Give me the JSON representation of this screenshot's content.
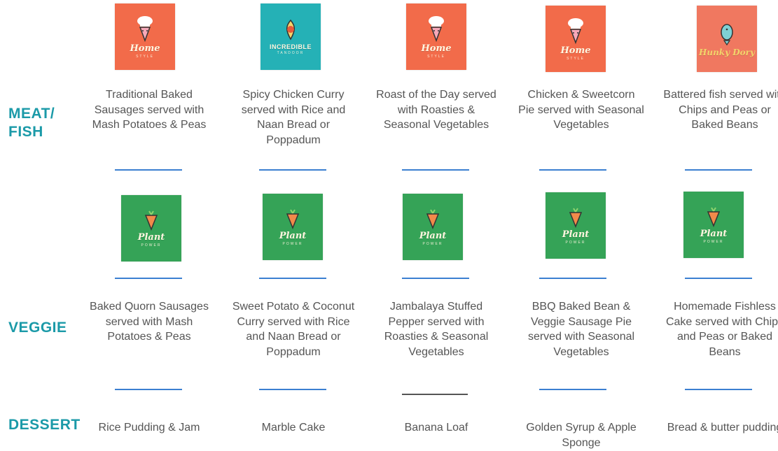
{
  "rows": {
    "meat": {
      "label_line1": "MEAT/",
      "label_line2": "FISH"
    },
    "veggie": {
      "label": "VEGGIE"
    },
    "dessert": {
      "label": "DESSERT"
    }
  },
  "brands": {
    "home_style": {
      "name": "Home",
      "sub": "STYLE",
      "color": "#f26b4a"
    },
    "incredible": {
      "name": "INCREDIBLE",
      "sub": "TANDOOR",
      "color": "#25b1b6"
    },
    "hunky_dory": {
      "name": "Hunky Dory",
      "color": "#f07860"
    },
    "plant_power": {
      "name": "Plant",
      "sub": "POWER",
      "color": "#35a357"
    }
  },
  "meat": [
    {
      "dish": "Traditional Baked Sausages served with Mash Potatoes & Peas",
      "brand": "Home",
      "sub": "STYLE"
    },
    {
      "dish": "Spicy Chicken Curry served with Rice and Naan Bread or Poppadum",
      "brand": "INCREDIBLE",
      "sub": "TANDOOR"
    },
    {
      "dish": "Roast of the Day served with Roasties & Seasonal Vegetables",
      "brand": "Home",
      "sub": "STYLE"
    },
    {
      "dish": "Chicken & Sweetcorn Pie served with Seasonal Vegetables",
      "brand": "Home",
      "sub": "STYLE"
    },
    {
      "dish": "Battered fish served with Chips and Peas or Baked Beans",
      "brand": "Hunky Dory"
    }
  ],
  "veggie": [
    {
      "dish": "Baked Quorn Sausages served with Mash Potatoes & Peas",
      "brand": "Plant",
      "sub": "POWER"
    },
    {
      "dish": "Sweet Potato & Coconut Curry served with Rice and Naan Bread or Poppadum",
      "brand": "Plant",
      "sub": "POWER"
    },
    {
      "dish": "Jambalaya Stuffed Pepper served with Roasties & Seasonal Vegetables",
      "brand": "Plant",
      "sub": "POWER"
    },
    {
      "dish": "BBQ Baked Bean & Veggie Sausage Pie served with Seasonal Vegetables",
      "brand": "Plant",
      "sub": "POWER"
    },
    {
      "dish": "Homemade Fishless Cake served with Chips and Peas or Baked Beans",
      "brand": "Plant",
      "sub": "POWER"
    }
  ],
  "dessert": [
    {
      "dish": "Rice Pudding & Jam"
    },
    {
      "dish": "Marble Cake"
    },
    {
      "dish": "Banana Loaf"
    },
    {
      "dish": "Golden Syrup & Apple Sponge"
    },
    {
      "dish": "Bread & butter pudding"
    }
  ]
}
